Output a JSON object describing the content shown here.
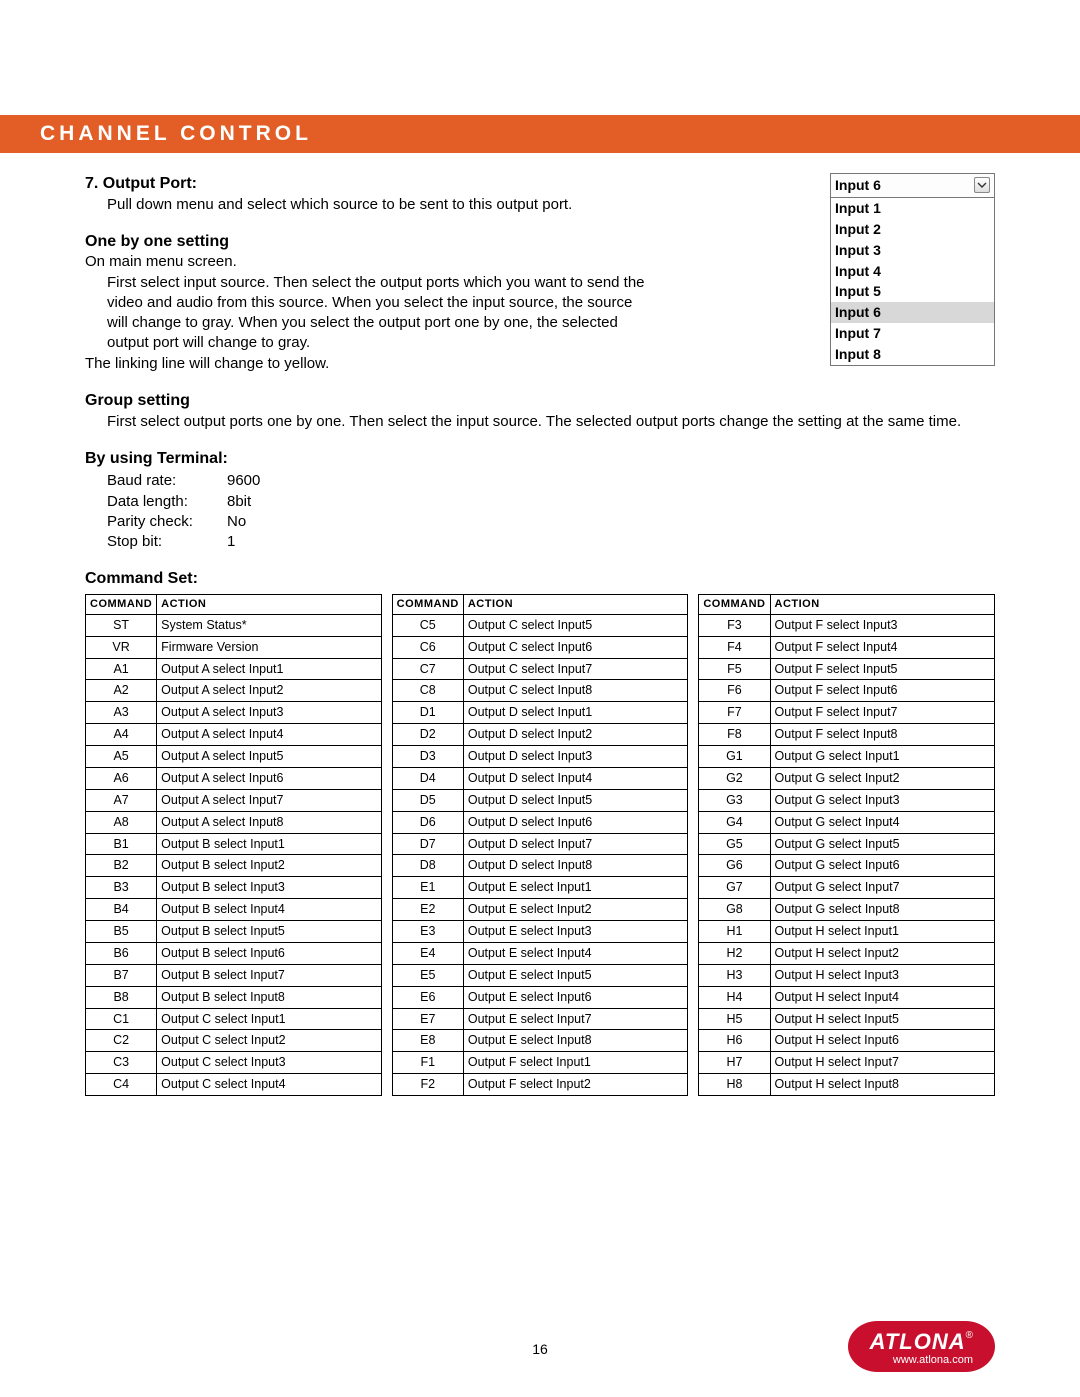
{
  "header": {
    "title": "CHANNEL CONTROL"
  },
  "section7": {
    "heading": "7. Output Port:",
    "body": "Pull down menu and select which source to be sent to this output port."
  },
  "dropdown": {
    "selected": "Input 6",
    "options": [
      "Input 1",
      "Input 2",
      "Input 3",
      "Input 4",
      "Input 5",
      "Input 6",
      "Input 7",
      "Input 8"
    ],
    "highlighted_index": 5
  },
  "onebyone": {
    "heading": "One by one setting",
    "line1": "On main menu screen.",
    "body": "First select input source. Then select the output ports which you want to send the video and audio from this source. When you select the input source, the source will change to gray. When you select the output port one by one, the selected output port will change to gray.",
    "line2": "The linking line will change to yellow."
  },
  "group": {
    "heading": "Group setting",
    "body": "First select output ports one by one. Then select the input source. The selected output ports change the setting at the same time."
  },
  "terminal": {
    "heading": "By using Terminal:",
    "rows": [
      {
        "k": "Baud rate:",
        "v": "9600"
      },
      {
        "k": "Data length:",
        "v": "8bit"
      },
      {
        "k": "Parity check:",
        "v": "No"
      },
      {
        "k": "Stop bit:",
        "v": "1"
      }
    ]
  },
  "commandset": {
    "heading": "Command Set:",
    "headers": {
      "cmd": "Command",
      "act": "Action"
    },
    "cols": [
      [
        {
          "c": "ST",
          "a": "System Status*"
        },
        {
          "c": "VR",
          "a": "Firmware Version"
        },
        {
          "c": "A1",
          "a": "Output A select Input1"
        },
        {
          "c": "A2",
          "a": "Output A select Input2"
        },
        {
          "c": "A3",
          "a": "Output A select Input3"
        },
        {
          "c": "A4",
          "a": "Output A select Input4"
        },
        {
          "c": "A5",
          "a": "Output A select Input5"
        },
        {
          "c": "A6",
          "a": "Output A select Input6"
        },
        {
          "c": "A7",
          "a": "Output A select Input7"
        },
        {
          "c": "A8",
          "a": "Output A select Input8"
        },
        {
          "c": "B1",
          "a": "Output B select Input1"
        },
        {
          "c": "B2",
          "a": "Output B select Input2"
        },
        {
          "c": "B3",
          "a": "Output B select Input3"
        },
        {
          "c": "B4",
          "a": "Output B select Input4"
        },
        {
          "c": "B5",
          "a": "Output B select Input5"
        },
        {
          "c": "B6",
          "a": "Output B select Input6"
        },
        {
          "c": "B7",
          "a": "Output B select Input7"
        },
        {
          "c": "B8",
          "a": "Output B select Input8"
        },
        {
          "c": "C1",
          "a": "Output C select Input1"
        },
        {
          "c": "C2",
          "a": "Output C select Input2"
        },
        {
          "c": "C3",
          "a": "Output C select Input3"
        },
        {
          "c": "C4",
          "a": "Output C select Input4"
        }
      ],
      [
        {
          "c": "C5",
          "a": "Output C select Input5"
        },
        {
          "c": "C6",
          "a": "Output C select Input6"
        },
        {
          "c": "C7",
          "a": "Output C select Input7"
        },
        {
          "c": "C8",
          "a": "Output C select Input8"
        },
        {
          "c": "D1",
          "a": "Output D select Input1"
        },
        {
          "c": "D2",
          "a": "Output D select Input2"
        },
        {
          "c": "D3",
          "a": "Output D select Input3"
        },
        {
          "c": "D4",
          "a": "Output D select Input4"
        },
        {
          "c": "D5",
          "a": "Output D select Input5"
        },
        {
          "c": "D6",
          "a": "Output D select Input6"
        },
        {
          "c": "D7",
          "a": "Output D select Input7"
        },
        {
          "c": "D8",
          "a": "Output D select Input8"
        },
        {
          "c": "E1",
          "a": "Output E select Input1"
        },
        {
          "c": "E2",
          "a": "Output E select Input2"
        },
        {
          "c": "E3",
          "a": "Output E select Input3"
        },
        {
          "c": "E4",
          "a": "Output E select Input4"
        },
        {
          "c": "E5",
          "a": "Output E select Input5"
        },
        {
          "c": "E6",
          "a": "Output E select Input6"
        },
        {
          "c": "E7",
          "a": "Output E select Input7"
        },
        {
          "c": "E8",
          "a": "Output E select Input8"
        },
        {
          "c": "F1",
          "a": "Output F select Input1"
        },
        {
          "c": "F2",
          "a": "Output F select Input2"
        }
      ],
      [
        {
          "c": "F3",
          "a": "Output F select Input3"
        },
        {
          "c": "F4",
          "a": "Output F select Input4"
        },
        {
          "c": "F5",
          "a": "Output F select Input5"
        },
        {
          "c": "F6",
          "a": "Output F select Input6"
        },
        {
          "c": "F7",
          "a": "Output F select Input7"
        },
        {
          "c": "F8",
          "a": "Output F select Input8"
        },
        {
          "c": "G1",
          "a": "Output G select Input1"
        },
        {
          "c": "G2",
          "a": "Output G select Input2"
        },
        {
          "c": "G3",
          "a": "Output G select Input3"
        },
        {
          "c": "G4",
          "a": "Output G select Input4"
        },
        {
          "c": "G5",
          "a": "Output G select Input5"
        },
        {
          "c": "G6",
          "a": "Output G select Input6"
        },
        {
          "c": "G7",
          "a": "Output G select Input7"
        },
        {
          "c": "G8",
          "a": "Output G select Input8"
        },
        {
          "c": "H1",
          "a": "Output H select Input1"
        },
        {
          "c": "H2",
          "a": "Output H select Input2"
        },
        {
          "c": "H3",
          "a": "Output H select Input3"
        },
        {
          "c": "H4",
          "a": "Output H select Input4"
        },
        {
          "c": "H5",
          "a": "Output H select Input5"
        },
        {
          "c": "H6",
          "a": "Output H select Input6"
        },
        {
          "c": "H7",
          "a": "Output H select Input7"
        },
        {
          "c": "H8",
          "a": "Output H select Input8"
        }
      ]
    ]
  },
  "footer": {
    "page": "16",
    "brand": "ATLONA",
    "url": "www.atlona.com"
  }
}
